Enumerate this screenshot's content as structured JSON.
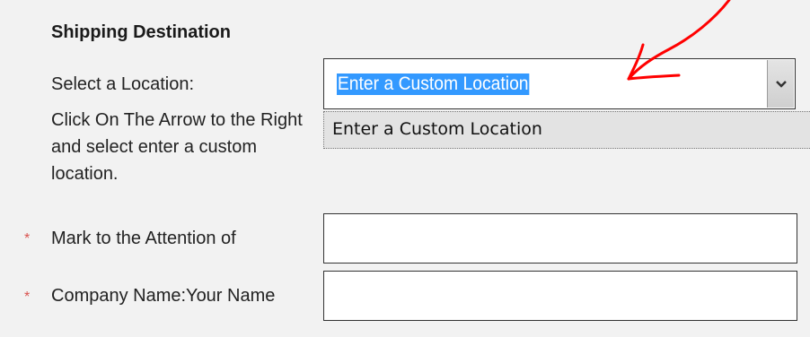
{
  "form": {
    "section_title": "Shipping Destination",
    "location_label": "Select a Location:",
    "location_help": "Click On The Arrow to the Right and select enter a custom location.",
    "location_select": {
      "selected_value": "Enter a Custom Location",
      "options": [
        "Enter a Custom Location"
      ]
    },
    "attention_label": "Mark to the Attention of",
    "attention_value": "",
    "company_label": "Company Name:Your Name",
    "company_value": "",
    "required_marker": "*"
  },
  "annotation": {
    "color": "#ff0000",
    "icon": "hand-drawn-arrow-icon"
  }
}
